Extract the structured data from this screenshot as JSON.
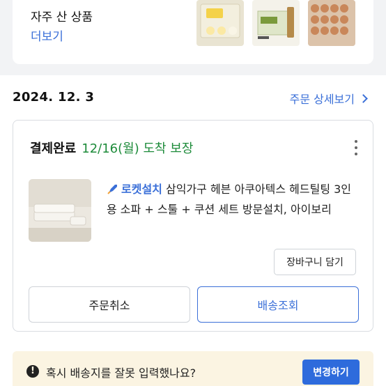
{
  "frequent": {
    "title": "자주 산 상품",
    "more_label": "더보기"
  },
  "order": {
    "date": "2024. 12. 3",
    "detail_link": "주문 상세보기",
    "status": "결제완료",
    "arrival": "12/16(월) 도착 보장",
    "product": {
      "badge": "로켓설치",
      "name": "삼익가구 헤븐 아쿠아텍스 헤드틸팅 3인용 소파 + 스툴 + 쿠션 세트 방문설치, 아이보리"
    },
    "cart_button": "장바구니 담기",
    "cancel_button": "주문취소",
    "track_button": "배송조회"
  },
  "notice": {
    "text": "혹시 배송지를 잘못 입력했나요?",
    "button": "변경하기"
  },
  "colors": {
    "accent": "#3a6fd8",
    "arrival_green": "#1d8b3a",
    "notice_bg": "#fbf4e2"
  }
}
